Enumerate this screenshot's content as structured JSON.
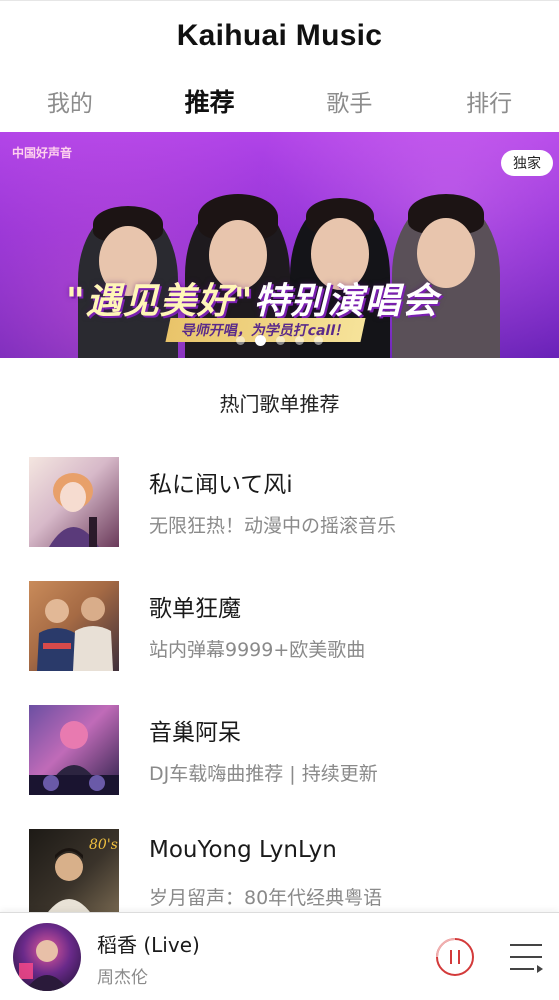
{
  "header": {
    "title": "Kaihuai Music"
  },
  "tabs": [
    {
      "label": "我的",
      "active": false
    },
    {
      "label": "推荐",
      "active": true
    },
    {
      "label": "歌手",
      "active": false
    },
    {
      "label": "排行",
      "active": false
    }
  ],
  "banner": {
    "badge": "独家",
    "logo_text": "中国好声音",
    "headline_part1": "\"遇见美好\"",
    "headline_part2": "特别演唱会",
    "subline": "导师开唱，为学员打call！",
    "dots": 5,
    "active_dot": 1,
    "colors": {
      "primary": "#9a35d8",
      "headline": "#fff6b8"
    }
  },
  "section": {
    "title": "热门歌单推荐"
  },
  "playlists": [
    {
      "name": "私に闻いて风i",
      "desc": "无限狂热！动漫中の摇滚音乐",
      "cover_icon": "anime-cover-image"
    },
    {
      "name": "歌单狂魔",
      "desc": "站内弹幕9999+欧美歌曲",
      "cover_icon": "duo-photo-cover-image"
    },
    {
      "name": "音巢阿呆",
      "desc": "DJ车载嗨曲推荐 | 持续更新",
      "cover_icon": "dj-cover-image"
    },
    {
      "name": "MouYong LynLyn",
      "desc": "岁月留声：80年代经典粤语",
      "cover_icon": "80s-cover-image"
    }
  ],
  "player": {
    "title": "稻香 (Live)",
    "artist": "周杰伦",
    "state": "playing",
    "accent": "#d33a3a"
  }
}
